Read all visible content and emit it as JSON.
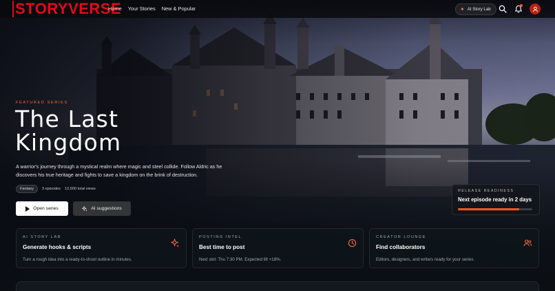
{
  "brand": {
    "name": "STORYVERSE",
    "color": "#e50914"
  },
  "nav": {
    "links": [
      "Home",
      "Your Stories",
      "New & Popular"
    ],
    "ai_lab_label": "AI Story Lab",
    "icons": [
      "search-icon",
      "bell-icon",
      "user-icon"
    ]
  },
  "hero": {
    "featured_label": "FEATURED SERIES",
    "title": "The Last Kingdom",
    "description": "A warrior's journey through a mystical realm where magic and steel collide. Follow Aldric as he discovers his true heritage and fights to save a kingdom on the brink of destruction.",
    "genre": "Fantasy",
    "episodes": "3 episodes",
    "views": "12,500 total views",
    "open_button": "Open series",
    "ai_button": "AI suggestions"
  },
  "release": {
    "label": "RELEASE READINESS",
    "value": "Next episode ready in 2 days",
    "progress": 0.82,
    "accent": "#ff5a1f"
  },
  "cards": [
    {
      "kicker": "AI STORY LAB",
      "title": "Generate hooks & scripts",
      "desc": "Turn a rough idea into a ready-to-shoot outline in minutes.",
      "icon": "sparkle-icon"
    },
    {
      "kicker": "POSTING INTEL",
      "title": "Best time to post",
      "desc": "Next slot: Thu 7:30 PM. Expected lift +18%.",
      "icon": "clock-icon"
    },
    {
      "kicker": "CREATOR LOUNGE",
      "title": "Find collaborators",
      "desc": "Editors, designers, and writers ready for your series.",
      "icon": "users-icon"
    }
  ]
}
